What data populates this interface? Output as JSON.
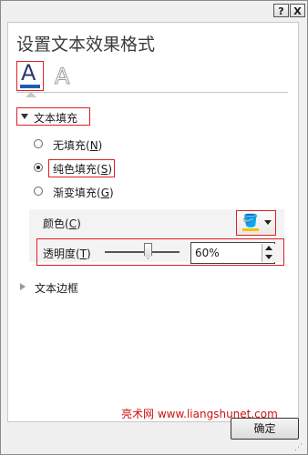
{
  "titlebar": {
    "help_label": "?",
    "close_label": "X"
  },
  "pane": {
    "title": "设置文本效果格式"
  },
  "tabs": [
    {
      "glyph": "A",
      "name": "text-fill-outline",
      "selected": true
    },
    {
      "glyph": "A",
      "name": "text-effects",
      "selected": false
    }
  ],
  "text_fill": {
    "header": "文本填充",
    "expanded": true,
    "options": [
      {
        "label": "无填充(",
        "key": "N",
        "suffix": ")",
        "selected": false
      },
      {
        "label": "纯色填充(",
        "key": "S",
        "suffix": ")",
        "selected": true
      },
      {
        "label": "渐变填充(",
        "key": "G",
        "suffix": ")",
        "selected": false
      }
    ],
    "color": {
      "label": "颜色(",
      "key": "C",
      "suffix": ")",
      "swatch": "#f6c000"
    },
    "transparency": {
      "label": "透明度(",
      "key": "T",
      "suffix": ")",
      "value": "60%",
      "percent": 60
    }
  },
  "text_border": {
    "header": "文本边框",
    "expanded": false
  },
  "watermark": "亮术网 www.liangshunet.com",
  "ok_label": "确定",
  "colors": {
    "highlight": "#e02020",
    "accent": "#1f5cb0"
  }
}
